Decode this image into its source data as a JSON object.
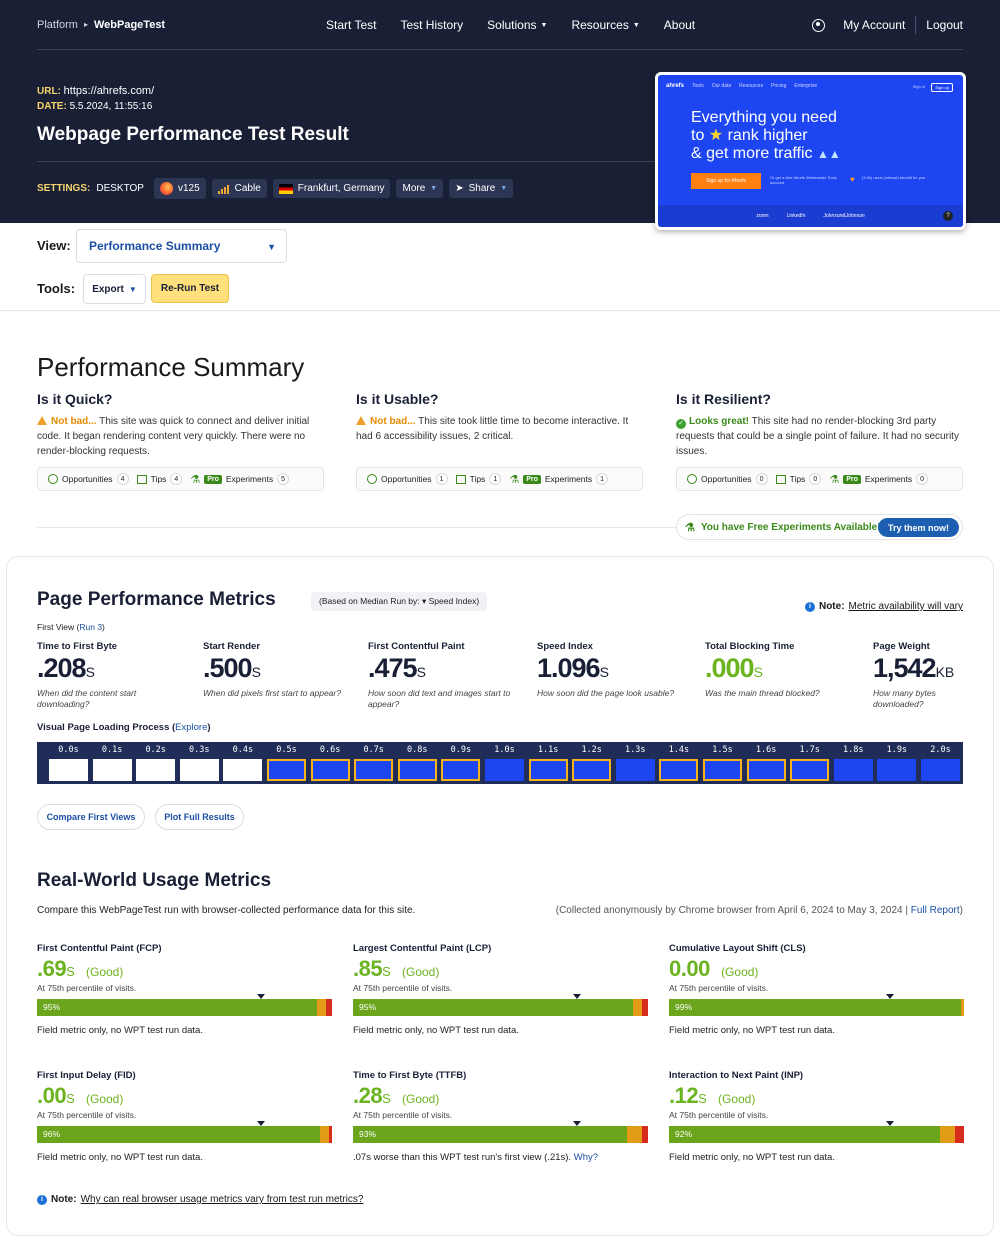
{
  "nav": {
    "platform": "Platform",
    "separator": "▸",
    "brand": "WebPageTest",
    "links": [
      "Start Test",
      "Test History",
      "Solutions",
      "Resources",
      "About"
    ],
    "account": "My Account",
    "logout": "Logout"
  },
  "test": {
    "url_label": "URL:",
    "url": "https://ahrefs.com/",
    "date_label": "DATE:",
    "date": "5.5.2024, 11:55:16",
    "title": "Webpage Performance Test Result",
    "settings_label": "SETTINGS:",
    "device": "DESKTOP",
    "browser": "v125",
    "connection": "Cable",
    "location": "Frankfurt, Germany",
    "more": "More",
    "share": "Share"
  },
  "thumbnail": {
    "logo": "ahrefs",
    "nav": [
      "Tools",
      "Our data",
      "Resources",
      "Pricing",
      "Enterprise"
    ],
    "signin": "Sign in",
    "signup": "Sign up",
    "headline1": "Everything you need",
    "headline2a": "to ",
    "headline2b": " rank higher",
    "headline3": "& get more traffic",
    "cta": "Sign up for Ahrefs",
    "sub1": "Or get a free Ahrefs Webmaster Tools account",
    "sub2": "(3.9k) users (almost) benefit for you",
    "logos": [
      "zoom",
      "LinkedIn",
      "Johnson&Johnson"
    ],
    "help": "?"
  },
  "view": {
    "label": "View:",
    "selected": "Performance Summary",
    "tools_label": "Tools:",
    "export": "Export",
    "rerun": "Re-Run Test"
  },
  "summary": {
    "title": "Performance Summary",
    "columns": [
      {
        "heading": "Is it Quick?",
        "status": "Not bad...",
        "text": " This site was quick to connect and deliver initial code. It began rendering content very quickly. There were no render-blocking requests.",
        "opportunities": "4",
        "tips": "4",
        "experiments": "5"
      },
      {
        "heading": "Is it Usable?",
        "status": "Not bad...",
        "text": " This site took little time to become interactive. It had 6 accessibility issues, 2 critical.",
        "opportunities": "1",
        "tips": "1",
        "experiments": "1"
      },
      {
        "heading": "Is it Resilient?",
        "status": "Looks great!",
        "text": " This site had no render-blocking 3rd party requests that could be a single point of failure. It had no security issues.",
        "opportunities": "0",
        "tips": "0",
        "experiments": "0"
      }
    ],
    "labels": {
      "opportunities": "Opportunities",
      "tips": "Tips",
      "pro": "Pro",
      "experiments": "Experiments"
    },
    "free_experiments": "You have Free Experiments Available!",
    "try_now": "Try them now!"
  },
  "metrics": {
    "title": "Page Performance Metrics",
    "median": "(Based on Median Run by: ▾ Speed Index)",
    "note_label": "Note:",
    "note_text": "Metric availability will vary",
    "first_view": "First View (",
    "run": "Run 3",
    "first_view_end": ")",
    "items": [
      {
        "label": "Time to First Byte",
        "value": ".208",
        "unit": "S",
        "desc": "When did the content start downloading?"
      },
      {
        "label": "Start Render",
        "value": ".500",
        "unit": "S",
        "desc": "When did pixels first start to appear?"
      },
      {
        "label": "First Contentful Paint",
        "value": ".475",
        "unit": "S",
        "desc": "How soon did text and images start to appear?"
      },
      {
        "label": "Speed Index",
        "value": "1.096",
        "unit": "S",
        "desc": "How soon did the page look usable?"
      },
      {
        "label": "Total Blocking Time",
        "value": ".000",
        "unit": "S",
        "desc": "Was the main thread blocked?"
      },
      {
        "label": "Page Weight",
        "value": "1,542",
        "unit": "KB",
        "desc": "How many bytes downloaded?"
      }
    ],
    "vplp": "Visual Page Loading Process",
    "explore": "Explore",
    "frames": [
      "0.0s",
      "0.1s",
      "0.2s",
      "0.3s",
      "0.4s",
      "0.5s",
      "0.6s",
      "0.7s",
      "0.8s",
      "0.9s",
      "1.0s",
      "1.1s",
      "1.2s",
      "1.3s",
      "1.4s",
      "1.5s",
      "1.6s",
      "1.7s",
      "1.8s",
      "1.9s",
      "2.0s"
    ],
    "compare": "Compare First Views",
    "plot": "Plot Full Results"
  },
  "realworld": {
    "title": "Real-World Usage Metrics",
    "compare": "Compare this WebPageTest run with browser-collected performance data for this site.",
    "collected": "(Collected anonymously by Chrome browser from April 6, 2024 to May 3, 2024 | ",
    "full_report": "Full Report",
    "collected_end": ")",
    "percentile": "At 75th percentile of visits.",
    "items": [
      {
        "label": "First Contentful Paint (FCP)",
        "value": ".69",
        "unit": "S",
        "rating": "(Good)",
        "good": 95,
        "ni": 3,
        "poor": 2,
        "marker": 0.76,
        "footer": "Field metric only, no WPT test run data."
      },
      {
        "label": "Largest Contentful Paint (LCP)",
        "value": ".85",
        "unit": "S",
        "rating": "(Good)",
        "good": 95,
        "ni": 3,
        "poor": 2,
        "marker": 0.76,
        "footer": "Field metric only, no WPT test run data."
      },
      {
        "label": "Cumulative Layout Shift (CLS)",
        "value": "0.00",
        "unit": "",
        "rating": "(Good)",
        "good": 99,
        "ni": 1,
        "poor": 0,
        "marker": 0.75,
        "footer": "Field metric only, no WPT test run data."
      },
      {
        "label": "First Input Delay (FID)",
        "value": ".00",
        "unit": "S",
        "rating": "(Good)",
        "good": 96,
        "ni": 3,
        "poor": 1,
        "marker": 0.76,
        "footer": "Field metric only, no WPT test run data."
      },
      {
        "label": "Time to First Byte (TTFB)",
        "value": ".28",
        "unit": "S",
        "rating": "(Good)",
        "good": 93,
        "ni": 5,
        "poor": 2,
        "marker": 0.76,
        "footer": ".07s worse than this WPT test run's first view (.21s).",
        "why": "Why?"
      },
      {
        "label": "Interaction to Next Paint (INP)",
        "value": ".12",
        "unit": "S",
        "rating": "(Good)",
        "good": 92,
        "ni": 5,
        "poor": 3,
        "marker": 0.75,
        "footer": "Field metric only, no WPT test run data."
      }
    ],
    "note_label": "Note:",
    "note_text": "Why can real browser usage metrics vary from test run metrics?"
  },
  "colors": {
    "navy": "#192036",
    "accent": "#1c4fa3",
    "good": "#6aa51b",
    "needs_improvement": "#e29b17",
    "poor": "#d52c1b",
    "thumb_blue": "#1d46f2"
  }
}
